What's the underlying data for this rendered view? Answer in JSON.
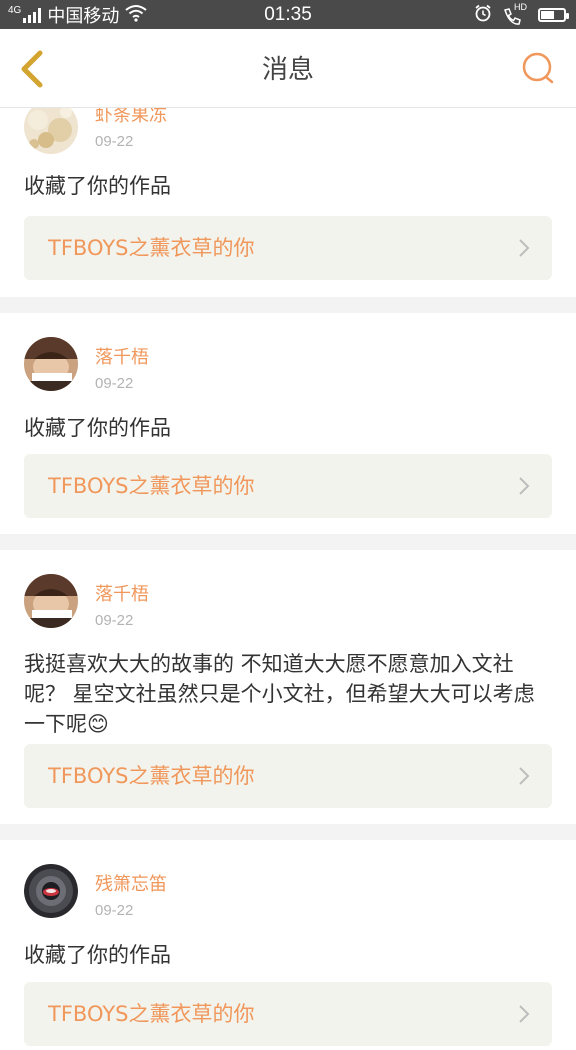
{
  "status_bar": {
    "network": "4G",
    "carrier": "中国移动",
    "time": "01:35",
    "hd": "HD",
    "battery_level": 0.55
  },
  "header": {
    "title": "消息",
    "accent_color": "#f0975b"
  },
  "messages": [
    {
      "user": "虾条果冻",
      "date": "09-22",
      "text": "收藏了你的作品",
      "work": "TFBOYS之薰衣草的你"
    },
    {
      "user": "落千梧",
      "date": "09-22",
      "text": "收藏了你的作品",
      "work": "TFBOYS之薰衣草的你"
    },
    {
      "user": "落千梧",
      "date": "09-22",
      "text": "我挺喜欢大大的故事的 不知道大大愿不愿意加入文社呢？ 星空文社虽然只是个小文社，但希望大大可以考虑一下呢😊",
      "work": "TFBOYS之薰衣草的你"
    },
    {
      "user": "残箫忘笛",
      "date": "09-22",
      "text": "收藏了你的作品",
      "work": "TFBOYS之薰衣草的你"
    }
  ]
}
